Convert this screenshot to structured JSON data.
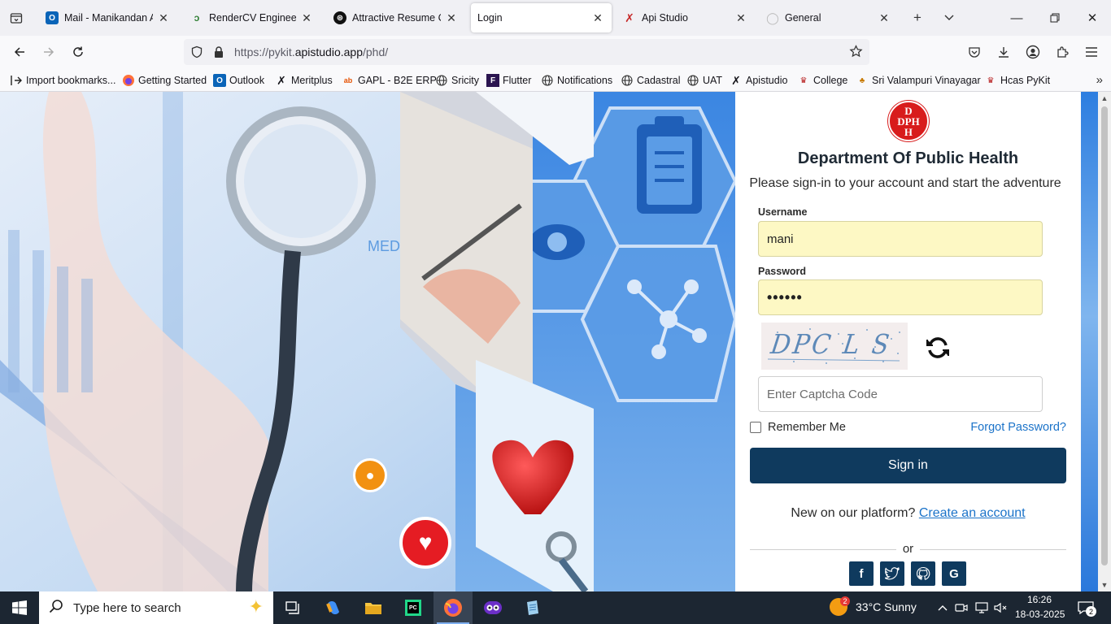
{
  "tabs": [
    {
      "title": "Mail - Manikandan Ani",
      "icon": "outlook-icon"
    },
    {
      "title": "RenderCV Engineering",
      "icon": "rendercv-icon"
    },
    {
      "title": "Attractive Resume Con",
      "icon": "chatgpt-icon"
    },
    {
      "title": "Login",
      "icon": "",
      "active": true
    },
    {
      "title": "Api Studio",
      "icon": "apistudio-icon"
    },
    {
      "title": "General",
      "icon": "github-icon"
    }
  ],
  "url": {
    "prefix": "https://pykit.",
    "domain": "apistudio.app",
    "path": "/phd/"
  },
  "bookmarks": [
    {
      "label": "Import bookmarks...",
      "icon": "import-icon"
    },
    {
      "label": "Getting Started",
      "icon": "firefox-icon"
    },
    {
      "label": "Outlook",
      "icon": "outlook-icon"
    },
    {
      "label": "Meritplus",
      "icon": "apistudio-icon"
    },
    {
      "label": "GAPL - B2E ERP",
      "icon": "erp-icon"
    },
    {
      "label": "Sricity",
      "icon": "globe-icon"
    },
    {
      "label": "Flutter",
      "icon": "flutter-icon"
    },
    {
      "label": "Notifications",
      "icon": "globe-icon"
    },
    {
      "label": "Cadastral",
      "icon": "globe-icon"
    },
    {
      "label": "UAT",
      "icon": "globe-icon"
    },
    {
      "label": "Apistudio",
      "icon": "apistudio-icon"
    },
    {
      "label": "College",
      "icon": "college-icon"
    },
    {
      "label": "Sri Valampuri Vinayagar",
      "icon": "temple-icon"
    },
    {
      "label": "Hcas PyKit",
      "icon": "college-icon"
    }
  ],
  "login": {
    "logo_letters": [
      "D",
      "DPH",
      "H"
    ],
    "title": "Department Of Public Health",
    "subtitle": "Please sign-in to your account and start the adventure",
    "username_label": "Username",
    "username_value": "mani",
    "password_label": "Password",
    "password_value": "••••••",
    "captcha_text": "DPC L S",
    "captcha_placeholder": "Enter Captcha Code",
    "remember_label": "Remember Me",
    "forgot_label": "Forgot Password?",
    "signin_label": "Sign in",
    "new_text": "New on our platform?",
    "create_label": "Create an account",
    "or_text": "or",
    "social": [
      "facebook-icon",
      "twitter-icon",
      "github-icon",
      "google-icon"
    ]
  },
  "taskbar": {
    "search_placeholder": "Type here to search",
    "weather_badge": "2",
    "weather": "33°C  Sunny",
    "time": "16:26",
    "date": "18-03-2025",
    "notif_count": "2"
  },
  "colors": {
    "accent": "#0f3a5e",
    "link": "#1b73c9",
    "logo": "#d81c1c",
    "autofill": "#fdf8c4"
  }
}
